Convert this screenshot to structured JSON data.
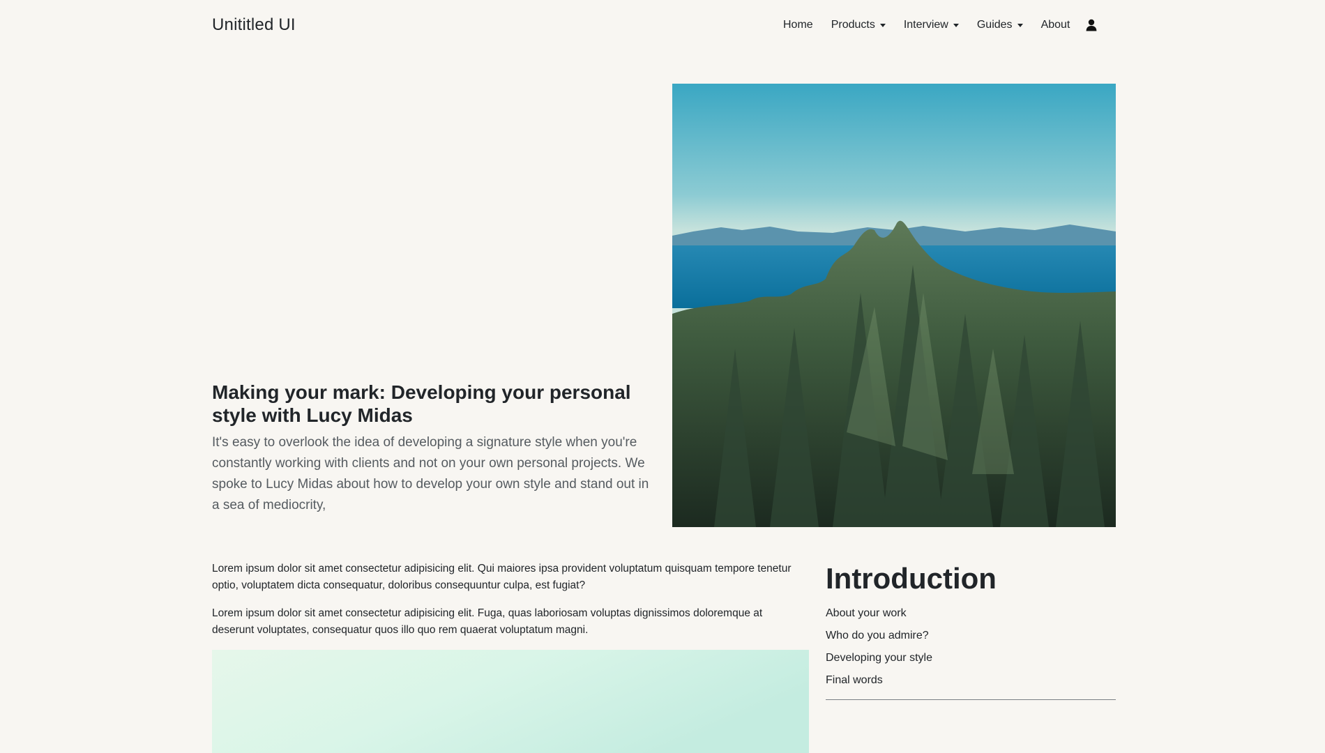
{
  "navbar": {
    "brand": "Unititled UI",
    "items": [
      {
        "label": "Home",
        "dropdown": false
      },
      {
        "label": "Products",
        "dropdown": true
      },
      {
        "label": "Interview",
        "dropdown": true
      },
      {
        "label": "Guides",
        "dropdown": true
      },
      {
        "label": "About",
        "dropdown": false
      }
    ],
    "user_icon": "user-icon"
  },
  "hero": {
    "title": "Making your mark: Developing your personal style with Lucy Midas",
    "lead": "It's easy to overlook the idea of developing a signature style when you're constantly working with clients and not on your own personal projects. We spoke to Lucy Midas about how to develop your own style and stand out in a sea of mediocrity,",
    "image": "forest-and-sea-photo"
  },
  "article": {
    "paragraphs": [
      "Lorem ipsum dolor sit amet consectetur adipisicing elit. Qui maiores ipsa provident voluptatum quisquam tempore tenetur optio, voluptatem dicta consequatur, doloribus consequuntur culpa, est fugiat?",
      "Lorem ipsum dolor sit amet consectetur adipisicing elit. Fuga, quas laboriosam voluptas dignissimos doloremque at deserunt voluptates, consequatur quos illo quo rem quaerat voluptatum magni."
    ],
    "image": "pale-sky-photo"
  },
  "sidebar": {
    "title": "Introduction",
    "items": [
      {
        "label": "About your work"
      },
      {
        "label": "Who do you admire?"
      },
      {
        "label": "Developing your style"
      },
      {
        "label": "Final words"
      }
    ]
  },
  "colors": {
    "background": "#f8f6f2",
    "text": "#212529",
    "lead_text": "#555b60"
  }
}
